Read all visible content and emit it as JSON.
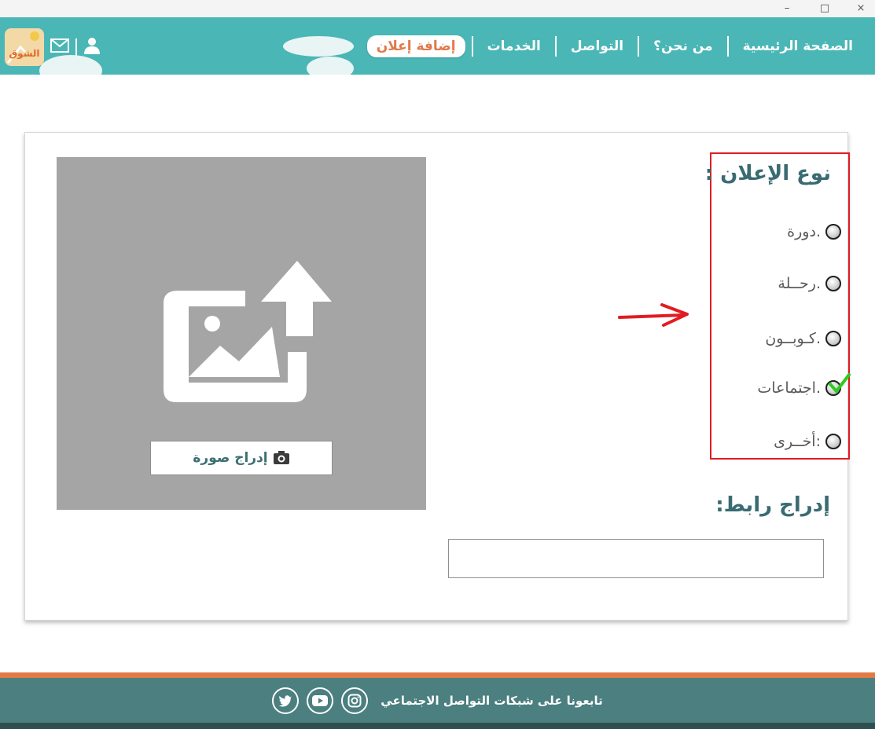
{
  "window": {
    "minimize_label": "–",
    "maximize_label": "□",
    "close_label": "×"
  },
  "header": {
    "logo_text": "الشوق",
    "nav": [
      {
        "label": "الصفحة الرئيسية"
      },
      {
        "label": "من نحن؟"
      },
      {
        "label": "التواصل"
      },
      {
        "label": "الخدمات"
      },
      {
        "label": "إضافة إعلان"
      }
    ]
  },
  "form": {
    "ad_type_title": "نوع الإعلان :",
    "options": [
      {
        "label": "دورة.",
        "checked": false
      },
      {
        "label": "رحــلة.",
        "checked": false
      },
      {
        "label": "كـوبــون.",
        "checked": false
      },
      {
        "label": "اجتماعات.",
        "checked": true
      },
      {
        "label": "أخــرى:",
        "checked": false
      }
    ],
    "insert_link_title": "إدراج رابط:",
    "link_value": "",
    "insert_image_label": "إدراج صورة"
  },
  "footer": {
    "follow_text": "تابعونا على شبكات التواصل الاجتماعي",
    "social": [
      "instagram-icon",
      "youtube-icon",
      "twitter-icon"
    ]
  },
  "colors": {
    "header": "#4ab7b6",
    "accent": "#e07a4a",
    "title_text": "#3a6b72",
    "footer": "#4b7f80",
    "highlight_border": "#e21b22",
    "check": "#2ecc1f"
  }
}
